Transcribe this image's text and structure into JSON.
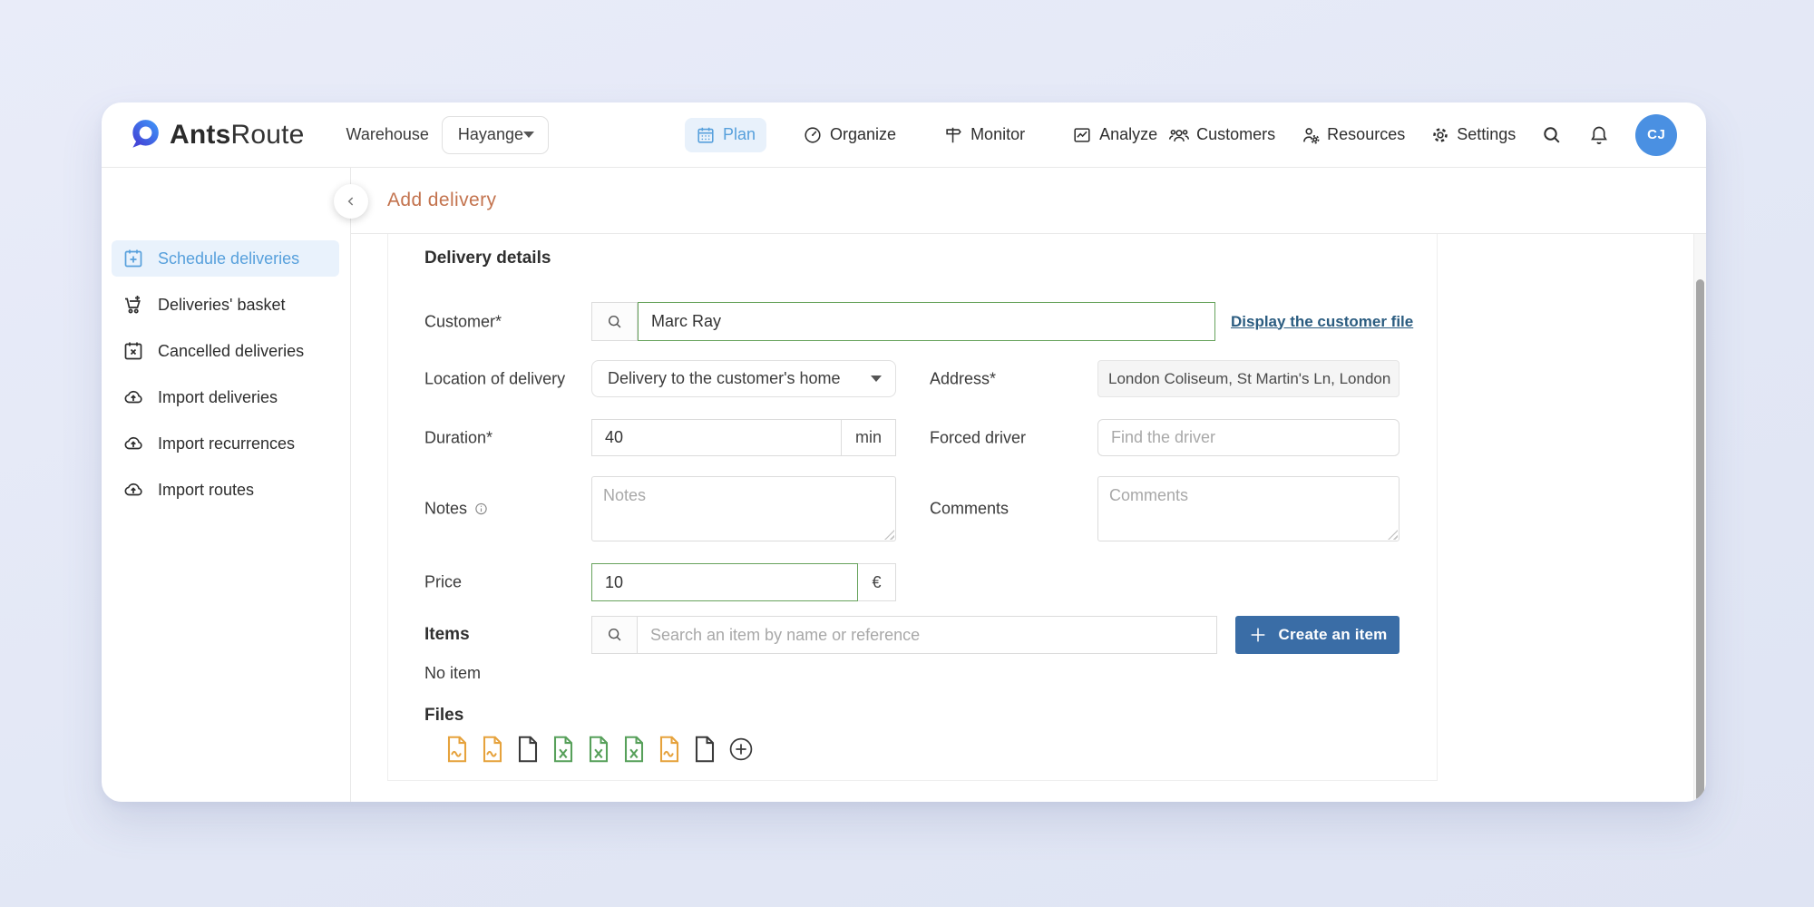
{
  "brand": {
    "bold": "Ants",
    "light": "Route"
  },
  "navbar": {
    "warehouse_label": "Warehouse",
    "warehouse_value": "Hayange",
    "tabs": [
      {
        "label": "Plan",
        "active": true
      },
      {
        "label": "Organize",
        "active": false
      },
      {
        "label": "Monitor",
        "active": false
      },
      {
        "label": "Analyze",
        "active": false
      }
    ],
    "links": [
      {
        "label": "Customers"
      },
      {
        "label": "Resources"
      },
      {
        "label": "Settings"
      }
    ],
    "avatar": "CJ"
  },
  "sidebar": {
    "items": [
      {
        "label": "Schedule deliveries",
        "active": true
      },
      {
        "label": "Deliveries' basket",
        "active": false
      },
      {
        "label": "Cancelled deliveries",
        "active": false
      },
      {
        "label": "Import deliveries",
        "active": false
      },
      {
        "label": "Import recurrences",
        "active": false
      },
      {
        "label": "Import routes",
        "active": false
      }
    ]
  },
  "header": {
    "title": "Add delivery"
  },
  "form": {
    "section_title": "Delivery details",
    "customer": {
      "label": "Customer*",
      "value": "Marc Ray",
      "link": "Display the customer file"
    },
    "location": {
      "label": "Location of delivery",
      "value": "Delivery to the customer's home"
    },
    "address": {
      "label": "Address*",
      "value": "London Coliseum, St Martin's Ln, London"
    },
    "duration": {
      "label": "Duration*",
      "value": "40",
      "unit": "min"
    },
    "forced_driver": {
      "label": "Forced driver",
      "placeholder": "Find the driver"
    },
    "notes": {
      "label": "Notes",
      "placeholder": "Notes"
    },
    "comments": {
      "label": "Comments",
      "placeholder": "Comments"
    },
    "price": {
      "label": "Price",
      "value": "10",
      "unit": "€"
    },
    "items": {
      "label": "Items",
      "placeholder": "Search an item by name or reference",
      "create_button": "Create an item",
      "empty": "No item"
    },
    "files": {
      "label": "Files",
      "icons": [
        "image",
        "image",
        "doc",
        "xls",
        "xls",
        "xls",
        "image",
        "doc",
        "add"
      ]
    }
  },
  "colors": {
    "accent_blue": "#57a0dc",
    "button_blue": "#3a6da6",
    "title_orange": "#c3734e",
    "link_navy": "#2b5c80",
    "green_border": "#67a35c",
    "avatar_blue": "#4a90e2"
  }
}
